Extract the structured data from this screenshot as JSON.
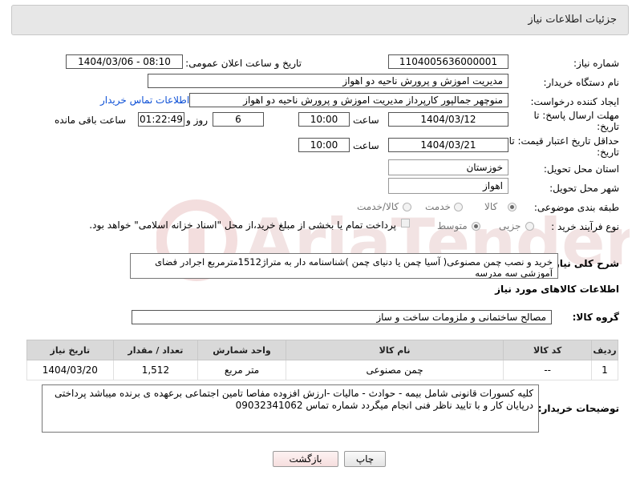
{
  "header": {
    "title": "جزئیات اطلاعات نیاز"
  },
  "form": {
    "need_number_label": "شماره نیاز:",
    "need_number": "1104005636000001",
    "announce_label": "تاریخ و ساعت اعلان عمومی:",
    "announce_value": "1404/03/06 - 08:10",
    "buyer_org_label": "نام دستگاه خریدار:",
    "buyer_org": "مدیریت اموزش و پرورش ناحیه دو اهواز",
    "creator_label": "ایجاد کننده درخواست:",
    "creator": "منوچهر  جمالپور کارپرداز مدیریت اموزش و پرورش ناحیه دو اهواز",
    "contact_link": "اطلاعات تماس خریدار",
    "reply_deadline_label": "مهلت ارسال پاسخ: تا تاریخ:",
    "reply_date": "1404/03/12",
    "time_label": "ساعت",
    "reply_time": "10:00",
    "days_value": "6",
    "days_label": "روز و",
    "remaining_value": "01:22:49",
    "remaining_label": "ساعت باقی مانده",
    "price_deadline_label": "حداقل تاریخ اعتبار قیمت: تا تاریخ:",
    "price_date": "1404/03/21",
    "price_time": "10:00",
    "province_label": "استان محل تحویل:",
    "province": "خوزستان",
    "city_label": "شهر محل تحویل:",
    "city": "اهواز",
    "category_label": "طبقه بندی موضوعی:",
    "category_options": [
      "کالا",
      "خدمت",
      "کالا/خدمت"
    ],
    "category_selected": "کالا",
    "process_label": "نوع فرآیند خرید :",
    "process_options": [
      "جزیی",
      "متوسط"
    ],
    "process_selected": "متوسط",
    "payment_note": "پرداخت تمام یا بخشی از مبلغ خرید،از محل \"اسناد خزانه اسلامی\" خواهد بود.",
    "general_desc_label": "شرح کلی نیاز:",
    "general_desc": "خرید و نصب چمن مصنوعی( آسیا چمن یا دنیای چمن )شناسنامه دار به متراژ1512مترمربع اجرادر فضای آموزشی سه مدرسه"
  },
  "goods": {
    "section_title": "اطلاعات کالاهای مورد نیاز",
    "group_label": "گروه کالا:",
    "group_value": "مصالح ساختمانی و ملزومات ساخت و ساز",
    "columns": [
      "ردیف",
      "کد کالا",
      "نام کالا",
      "واحد شمارش",
      "تعداد / مقدار",
      "تاریخ نیاز"
    ],
    "rows": [
      [
        "1",
        "--",
        "چمن مصنوعی",
        "متر مربع",
        "1,512",
        "1404/03/20"
      ]
    ]
  },
  "buyer_notes": {
    "label": "توضیحات خریدار:",
    "text": "کلیه کسورات قانونی شامل بیمه - حوادث - مالیات -ارزش افزوده مفاصا تامین اجتماعی برعهده ی برنده میباشد پرداختی درپایان کار و با تایید ناظر فنی انجام میگردد شماره تماس 09032341062"
  },
  "buttons": {
    "print": "چاپ",
    "back": "بازگشت"
  },
  "colors": {
    "header_bg": "#e7e7e7",
    "link": "#0c4fd6",
    "watermark": "#f3dede",
    "back_button": "#fbe7e7"
  }
}
